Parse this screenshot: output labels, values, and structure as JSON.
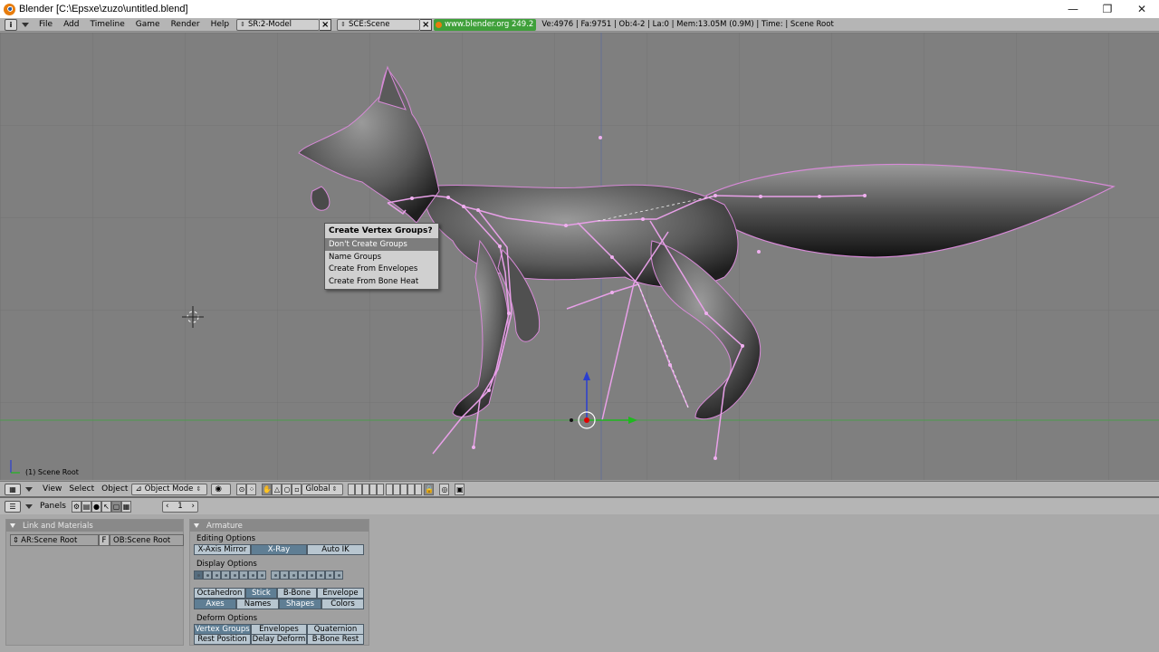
{
  "window": {
    "title": "Blender [C:\\Epsxe\\zuzo\\untitled.blend]",
    "min_glyph": "—",
    "max_glyph": "❐",
    "close_glyph": "✕"
  },
  "info_header": {
    "menu": [
      "File",
      "Add",
      "Timeline",
      "Game",
      "Render",
      "Help"
    ],
    "screen_field": "SR:2-Model",
    "scene_field": "SCE:Scene",
    "url": "www.blender.org 249.2",
    "stats": "Ve:4976 | Fa:9751 | Ob:4-2 | La:0  | Mem:13.05M (0.9M)  | Time: | Scene Root"
  },
  "viewport": {
    "object_info": "(1) Scene Root"
  },
  "popup": {
    "title": "Create Vertex Groups?",
    "items": [
      "Don't Create Groups",
      "Name Groups",
      "Create From Envelopes",
      "Create From Bone Heat"
    ],
    "highlighted_index": 0
  },
  "view3d_header": {
    "menu": [
      "View",
      "Select",
      "Object"
    ],
    "mode": "Object Mode",
    "orientation": "Global"
  },
  "buttons_header": {
    "panels_label": "Panels",
    "frame": "1"
  },
  "link_panel": {
    "title": "Link and Materials",
    "ar_field": "AR:Scene Root",
    "f_label": "F",
    "ob_field": "OB:Scene Root"
  },
  "armature_panel": {
    "title": "Armature",
    "editing_label": "Editing Options",
    "editing_buttons": [
      {
        "label": "X-Axis Mirror",
        "on": false
      },
      {
        "label": "X-Ray",
        "on": true
      },
      {
        "label": "Auto IK",
        "on": false
      }
    ],
    "display_label": "Display Options",
    "draw_type_buttons": [
      {
        "label": "Octahedron",
        "on": false
      },
      {
        "label": "Stick",
        "on": true
      },
      {
        "label": "B-Bone",
        "on": false
      },
      {
        "label": "Envelope",
        "on": false
      }
    ],
    "display_buttons": [
      {
        "label": "Axes",
        "on": true
      },
      {
        "label": "Names",
        "on": false
      },
      {
        "label": "Shapes",
        "on": true
      },
      {
        "label": "Colors",
        "on": false
      }
    ],
    "deform_label": "Deform Options",
    "deform_row1": [
      {
        "label": "Vertex Groups",
        "on": true
      },
      {
        "label": "Envelopes",
        "on": false
      },
      {
        "label": "Quaternion",
        "on": false
      }
    ],
    "deform_row2": [
      {
        "label": "Rest Position",
        "on": false
      },
      {
        "label": "Delay Deform",
        "on": false
      },
      {
        "label": "B-Bone Rest",
        "on": false
      }
    ]
  }
}
